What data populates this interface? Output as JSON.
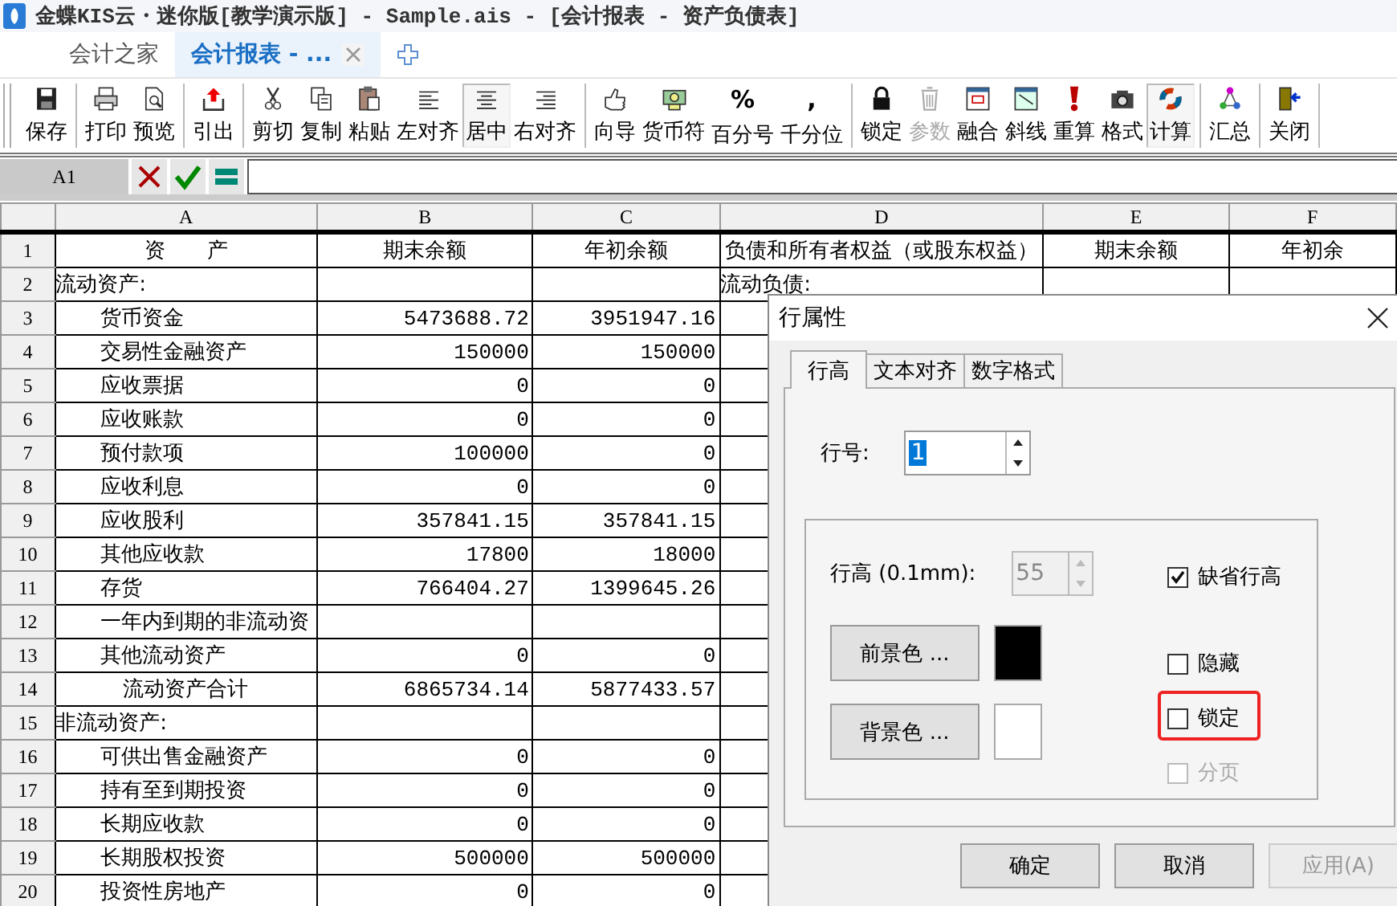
{
  "window": {
    "title": "金蝶KIS云・迷你版[教学演示版] - Sample.ais - [会计报表 - 资产负债表]"
  },
  "tabs": [
    {
      "label": "会计之家",
      "selected": false
    },
    {
      "label": "会计报表 - ...",
      "selected": true
    }
  ],
  "toolbar": {
    "groups": [
      [
        {
          "label": "保存",
          "disabled": false,
          "pressed": false
        }
      ],
      [
        {
          "label": "打印",
          "disabled": false,
          "pressed": false
        },
        {
          "label": "预览",
          "disabled": false,
          "pressed": false
        }
      ],
      [
        {
          "label": "引出",
          "disabled": false,
          "pressed": false
        }
      ],
      [
        {
          "label": "剪切",
          "disabled": false,
          "pressed": false
        },
        {
          "label": "复制",
          "disabled": false,
          "pressed": false
        },
        {
          "label": "粘贴",
          "disabled": false,
          "pressed": false
        },
        {
          "label": "左对齐",
          "disabled": false,
          "pressed": false
        },
        {
          "label": "居中",
          "disabled": false,
          "pressed": true
        },
        {
          "label": "右对齐",
          "disabled": false,
          "pressed": false
        }
      ],
      [
        {
          "label": "向导",
          "disabled": false,
          "pressed": false
        },
        {
          "label": "货币符",
          "disabled": false,
          "pressed": false
        },
        {
          "label": "百分号",
          "glyph": "%",
          "disabled": false,
          "pressed": false
        },
        {
          "label": "千分位",
          "glyph": ",",
          "disabled": false,
          "pressed": false
        }
      ],
      [
        {
          "label": "锁定",
          "disabled": false,
          "pressed": false
        },
        {
          "label": "参数",
          "disabled": true,
          "pressed": false
        },
        {
          "label": "融合",
          "disabled": false,
          "pressed": false
        },
        {
          "label": "斜线",
          "disabled": false,
          "pressed": false
        },
        {
          "label": "重算",
          "disabled": false,
          "pressed": false
        },
        {
          "label": "格式",
          "disabled": false,
          "pressed": false
        },
        {
          "label": "计算",
          "disabled": false,
          "pressed": true
        }
      ],
      [
        {
          "label": "汇总",
          "disabled": false,
          "pressed": false
        }
      ],
      [
        {
          "label": "关闭",
          "disabled": false,
          "pressed": false
        }
      ]
    ]
  },
  "formula_bar": {
    "cell_ref": "A1"
  },
  "sheet": {
    "columns": [
      "A",
      "B",
      "C",
      "D",
      "E",
      "F"
    ],
    "rows": [
      {
        "number": "1",
        "kind": "header",
        "cells": {
          "A": "资　　产",
          "B": "期末余额",
          "C": "年初余额",
          "D": "负债和所有者权益（或股东权益）",
          "E": "期末余额",
          "F": "年初余"
        }
      },
      {
        "number": "2",
        "kind": "section",
        "cells": {
          "A": "流动资产:",
          "D": "流动负债:"
        }
      },
      {
        "number": "3",
        "kind": "item",
        "cells": {
          "A": "货币资金",
          "B": "5473688.72",
          "C": "3951947.16"
        }
      },
      {
        "number": "4",
        "kind": "item",
        "cells": {
          "A": "交易性金融资产",
          "B": "150000",
          "C": "150000"
        }
      },
      {
        "number": "5",
        "kind": "item",
        "cells": {
          "A": "应收票据",
          "B": "0",
          "C": "0"
        }
      },
      {
        "number": "6",
        "kind": "item",
        "cells": {
          "A": "应收账款",
          "B": "0",
          "C": "0"
        }
      },
      {
        "number": "7",
        "kind": "item",
        "cells": {
          "A": "预付款项",
          "B": "100000",
          "C": "0"
        }
      },
      {
        "number": "8",
        "kind": "item",
        "cells": {
          "A": "应收利息",
          "B": "0",
          "C": "0"
        }
      },
      {
        "number": "9",
        "kind": "item",
        "cells": {
          "A": "应收股利",
          "B": "357841.15",
          "C": "357841.15"
        }
      },
      {
        "number": "10",
        "kind": "item",
        "cells": {
          "A": "其他应收款",
          "B": "17800",
          "C": "18000"
        }
      },
      {
        "number": "11",
        "kind": "item",
        "cells": {
          "A": "存货",
          "B": "766404.27",
          "C": "1399645.26"
        }
      },
      {
        "number": "12",
        "kind": "item",
        "cells": {
          "A": "一年内到期的非流动资"
        }
      },
      {
        "number": "13",
        "kind": "item",
        "cells": {
          "A": "其他流动资产",
          "B": "0",
          "C": "0"
        }
      },
      {
        "number": "14",
        "kind": "subtotal",
        "cells": {
          "A": "流动资产合计",
          "B": "6865734.14",
          "C": "5877433.57"
        }
      },
      {
        "number": "15",
        "kind": "section",
        "cells": {
          "A": "非流动资产:"
        }
      },
      {
        "number": "16",
        "kind": "item",
        "cells": {
          "A": "可供出售金融资产",
          "B": "0",
          "C": "0"
        }
      },
      {
        "number": "17",
        "kind": "item",
        "cells": {
          "A": "持有至到期投资",
          "B": "0",
          "C": "0"
        }
      },
      {
        "number": "18",
        "kind": "item",
        "cells": {
          "A": "长期应收款",
          "B": "0",
          "C": "0"
        }
      },
      {
        "number": "19",
        "kind": "item",
        "cells": {
          "A": "长期股权投资",
          "B": "500000",
          "C": "500000"
        }
      },
      {
        "number": "20",
        "kind": "item",
        "cells": {
          "A": "投资性房地产",
          "B": "0",
          "C": "0"
        }
      }
    ]
  },
  "dialog": {
    "title": "行属性",
    "tabs": [
      {
        "label": "行高",
        "selected": true
      },
      {
        "label": "文本对齐",
        "selected": false
      },
      {
        "label": "数字格式",
        "selected": false
      }
    ],
    "row_number": {
      "label": "行号:",
      "value": "1",
      "text_selected": true
    },
    "row_height": {
      "label": "行高 (0.1mm):",
      "value": "55",
      "disabled": true
    },
    "color_buttons": [
      {
        "label": "前景色 ...",
        "color": "#000000"
      },
      {
        "label": "背景色 ...",
        "color": "#ffffff"
      }
    ],
    "checkboxes": [
      {
        "label": "缺省行高",
        "checked": true,
        "disabled": false,
        "highlighted": false
      },
      {
        "label": "隐藏",
        "checked": false,
        "disabled": false,
        "highlighted": false
      },
      {
        "label": "锁定",
        "checked": false,
        "disabled": false,
        "highlighted": true
      },
      {
        "label": "分页",
        "checked": false,
        "disabled": true,
        "highlighted": false
      }
    ],
    "buttons": [
      {
        "label": "确定",
        "disabled": false
      },
      {
        "label": "取消",
        "disabled": false
      },
      {
        "label": "应用(A)",
        "disabled": true
      }
    ]
  }
}
